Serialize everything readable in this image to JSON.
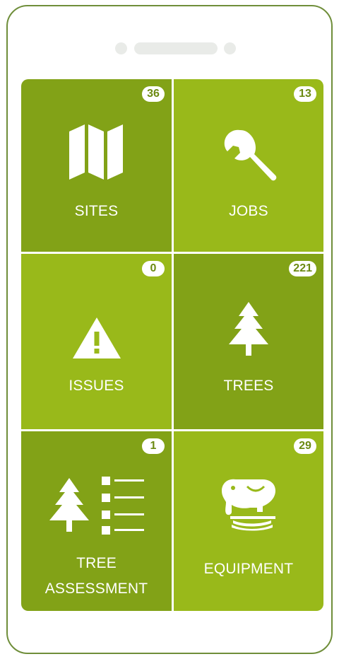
{
  "tiles": [
    {
      "label": "SITES",
      "count": "36",
      "icon": "map-icon",
      "color": "#82a217"
    },
    {
      "label": "JOBS",
      "count": "13",
      "icon": "wrench-icon",
      "color": "#99b91a"
    },
    {
      "label": "ISSUES",
      "count": "0",
      "icon": "warning-icon",
      "color": "#99b91a"
    },
    {
      "label": "TREES",
      "count": "221",
      "icon": "tree-icon",
      "color": "#82a217"
    },
    {
      "label_line1": "TREE",
      "label_line2": "ASSESSMENT",
      "count": "1",
      "icon": "tree-list-icon",
      "color": "#82a217"
    },
    {
      "label": "EQUIPMENT",
      "count": "29",
      "icon": "elephant-toy-icon",
      "color": "#99b91a"
    }
  ],
  "colors": {
    "frame": "#6f8e3a",
    "tile_dark": "#82a217",
    "tile_light": "#99b91a",
    "badge_text": "#6c8a12"
  }
}
